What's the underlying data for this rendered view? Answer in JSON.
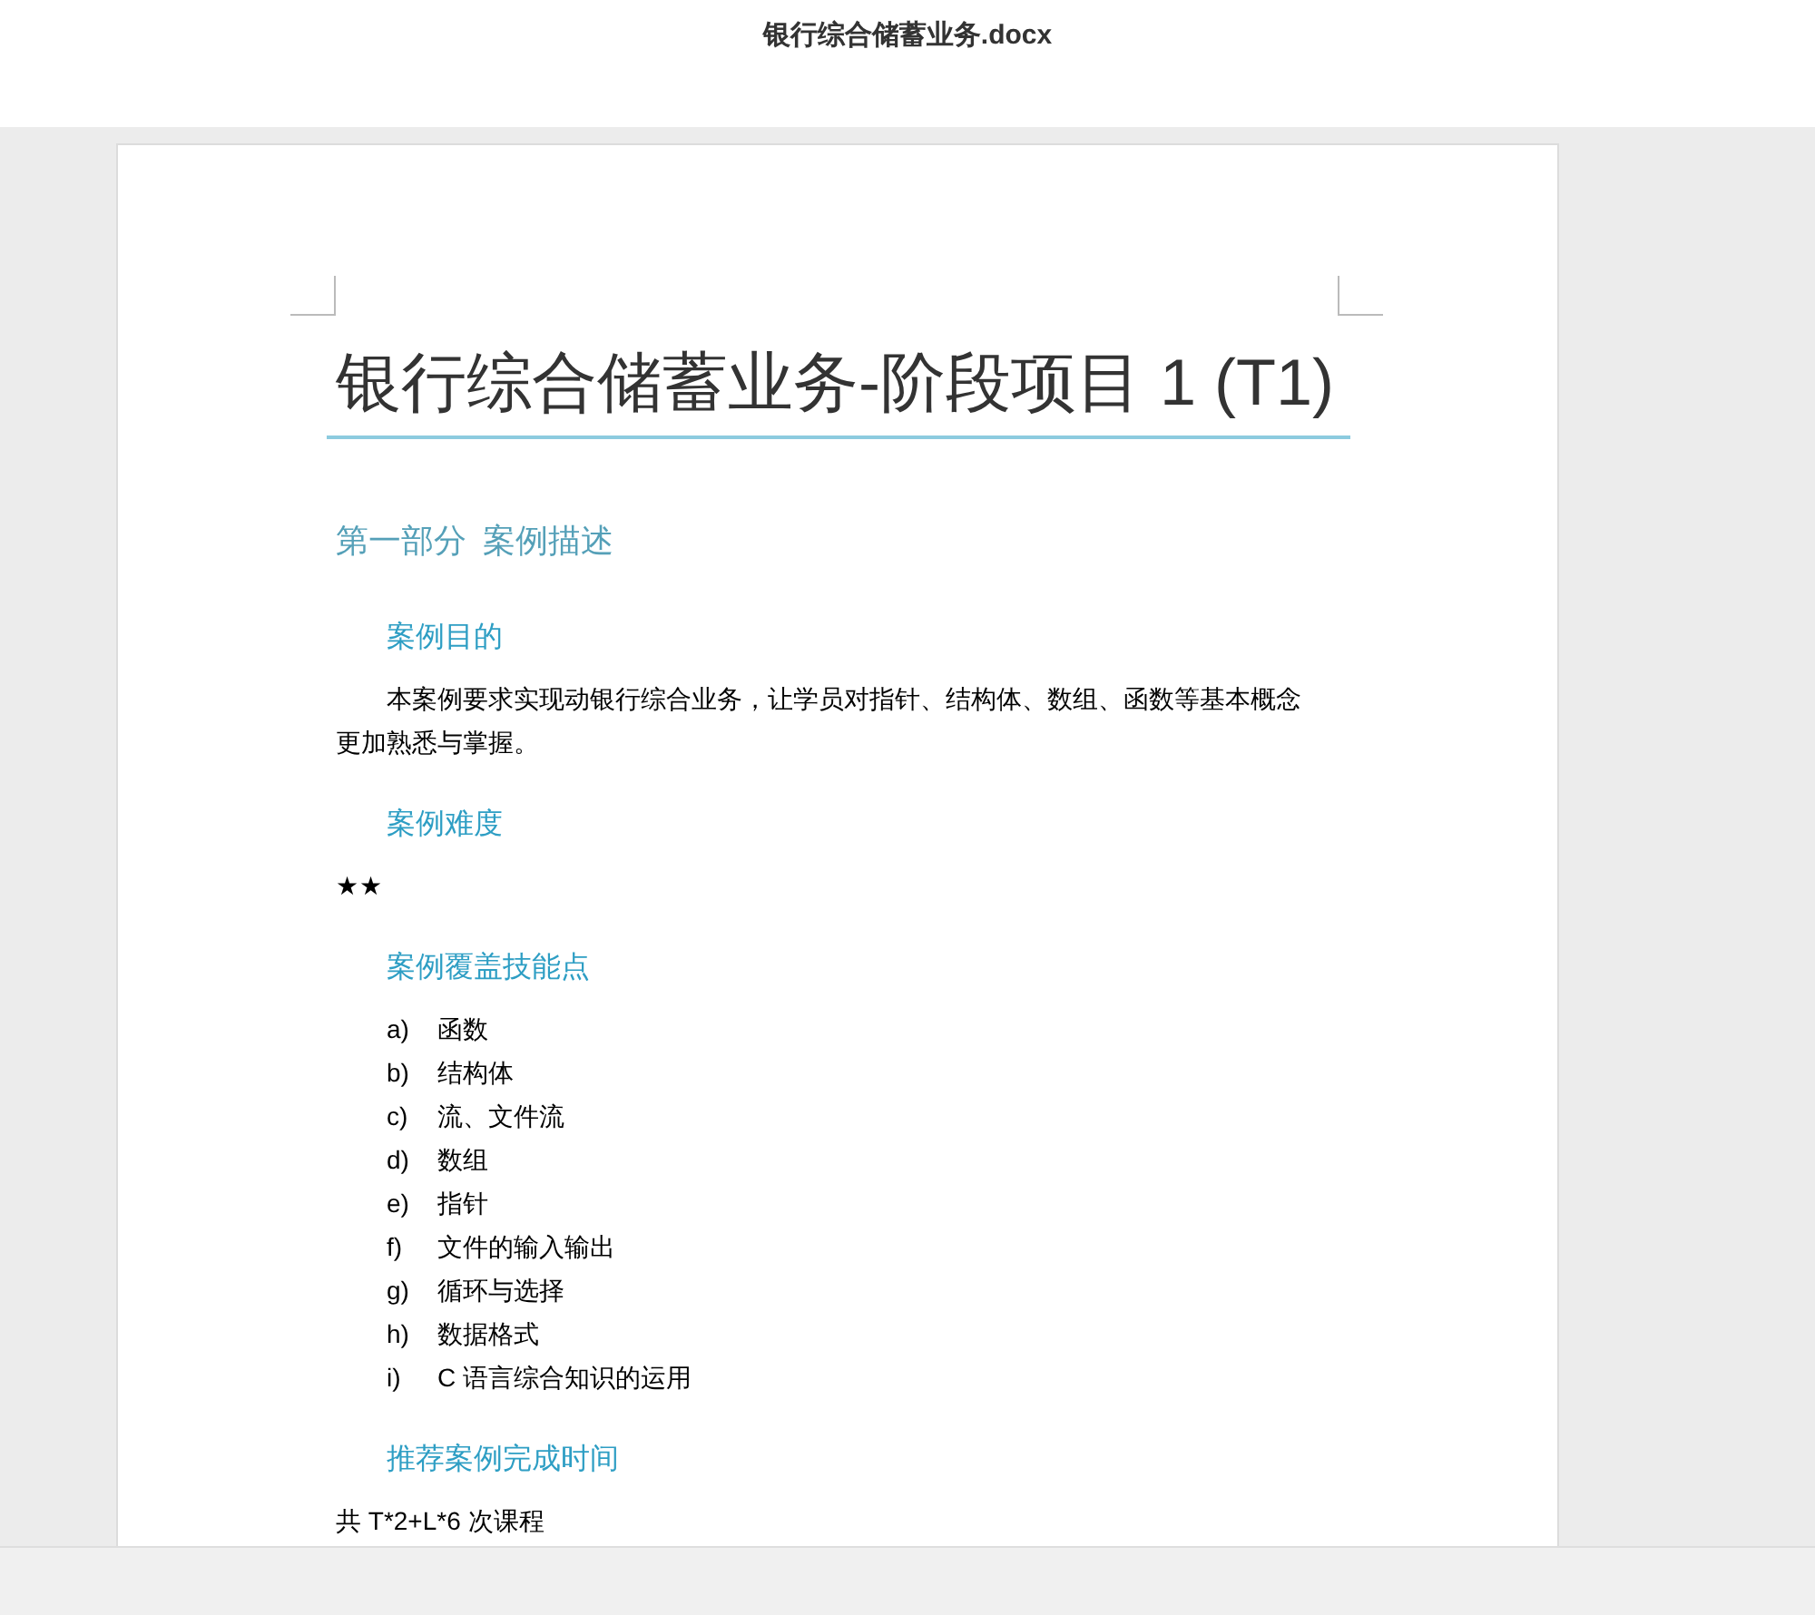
{
  "window": {
    "title": "银行综合储蓄业务.docx"
  },
  "document": {
    "title": "银行综合储蓄业务-阶段项目 1 (T1)",
    "section": "第一部分  案例描述",
    "blocks": [
      {
        "kind": "heading",
        "text": "案例目的"
      },
      {
        "kind": "paragraph",
        "text": "本案例要求实现动银行综合业务，让学员对指针、结构体、数组、函数等基本概念更加熟悉与掌握。"
      },
      {
        "kind": "heading",
        "text": "案例难度"
      },
      {
        "kind": "plain",
        "text": "★★"
      },
      {
        "kind": "heading",
        "text": "案例覆盖技能点"
      },
      {
        "kind": "list",
        "items": [
          {
            "marker": "a)",
            "text": "函数"
          },
          {
            "marker": "b)",
            "text": "结构体"
          },
          {
            "marker": "c)",
            "text": "流、文件流"
          },
          {
            "marker": "d)",
            "text": "数组"
          },
          {
            "marker": "e)",
            "text": "指针"
          },
          {
            "marker": "f)",
            "text": "文件的输入输出"
          },
          {
            "marker": "g)",
            "text": "循环与选择"
          },
          {
            "marker": "h)",
            "text": "数据格式"
          },
          {
            "marker": "i)",
            "text": "C 语言综合知识的运用"
          }
        ]
      },
      {
        "kind": "heading",
        "text": "推荐案例完成时间"
      },
      {
        "kind": "plain",
        "text": "共 T*2+L*6 次课程"
      }
    ]
  }
}
